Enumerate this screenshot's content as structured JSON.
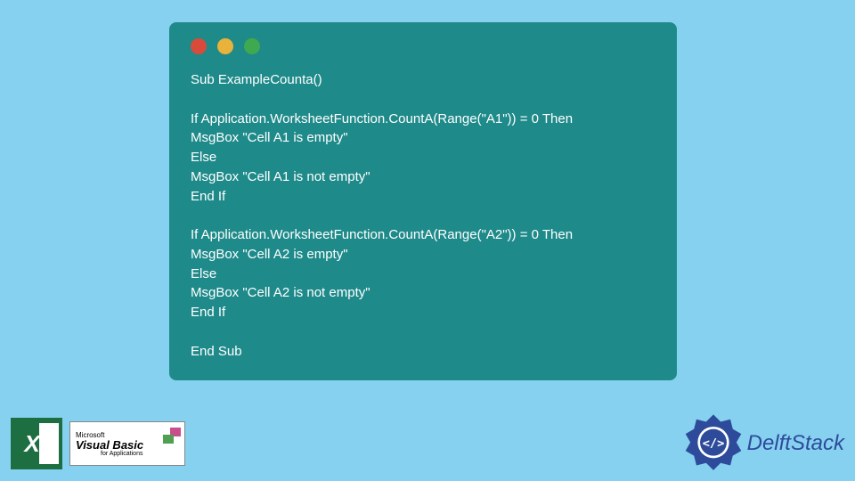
{
  "code": {
    "line1": "Sub ExampleCounta()",
    "line2": "If Application.WorksheetFunction.CountA(Range(\"A1\")) = 0 Then",
    "line3": "MsgBox \"Cell A1 is empty\"",
    "line4": "Else",
    "line5": "MsgBox \"Cell A1 is not empty\"",
    "line6": "End If",
    "line7": "If Application.WorksheetFunction.CountA(Range(\"A2\")) = 0 Then",
    "line8": "MsgBox \"Cell A2 is empty\"",
    "line9": "Else",
    "line10": "MsgBox \"Cell A2 is not empty\"",
    "line11": "End If",
    "line12": "End Sub"
  },
  "logos": {
    "excel_letter": "X",
    "vb_ms": "Microsoft",
    "vb_main": "Visual Basic",
    "vb_sub": "for Applications",
    "delft": "DelftStack"
  },
  "colors": {
    "bg": "#87d1f0",
    "window": "#1f8a8a",
    "delft_blue": "#2d4b9a"
  }
}
